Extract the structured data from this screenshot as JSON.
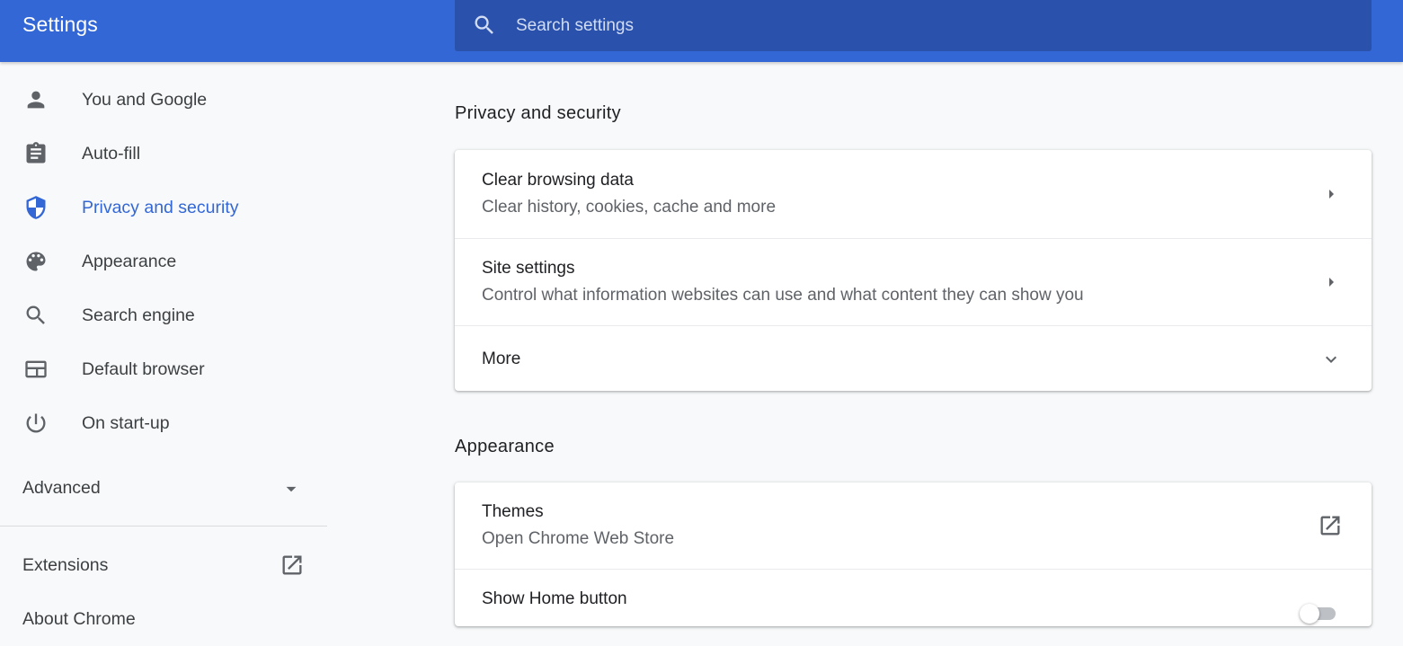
{
  "header": {
    "title": "Settings",
    "search": {
      "placeholder": "Search settings",
      "value": ""
    }
  },
  "sidebar": {
    "items": [
      {
        "label": "You and Google",
        "icon": "person-icon",
        "active": false
      },
      {
        "label": "Auto-fill",
        "icon": "clipboard-icon",
        "active": false
      },
      {
        "label": "Privacy and security",
        "icon": "shield-icon",
        "active": true
      },
      {
        "label": "Appearance",
        "icon": "palette-icon",
        "active": false
      },
      {
        "label": "Search engine",
        "icon": "search-icon",
        "active": false
      },
      {
        "label": "Default browser",
        "icon": "browser-icon",
        "active": false
      },
      {
        "label": "On start-up",
        "icon": "power-icon",
        "active": false
      }
    ],
    "advanced_label": "Advanced",
    "extensions_label": "Extensions",
    "about_label": "About Chrome"
  },
  "privacy": {
    "heading": "Privacy and security",
    "rows": [
      {
        "title": "Clear browsing data",
        "subtitle": "Clear history, cookies, cache and more",
        "icon": "arrow-right-icon"
      },
      {
        "title": "Site settings",
        "subtitle": "Control what information websites can use and what content they can show you",
        "icon": "arrow-right-icon"
      },
      {
        "title": "More",
        "icon": "chevron-down-icon"
      }
    ]
  },
  "appearance": {
    "heading": "Appearance",
    "rows": [
      {
        "title": "Themes",
        "subtitle": "Open Chrome Web Store",
        "icon": "open-in-new-icon"
      },
      {
        "title": "Show Home button",
        "toggle_on": false
      }
    ]
  },
  "colors": {
    "header_bg": "#3367d6",
    "search_bg": "#2a51ab",
    "active_accent": "#3367d6",
    "page_bg": "#f8f9fa"
  }
}
